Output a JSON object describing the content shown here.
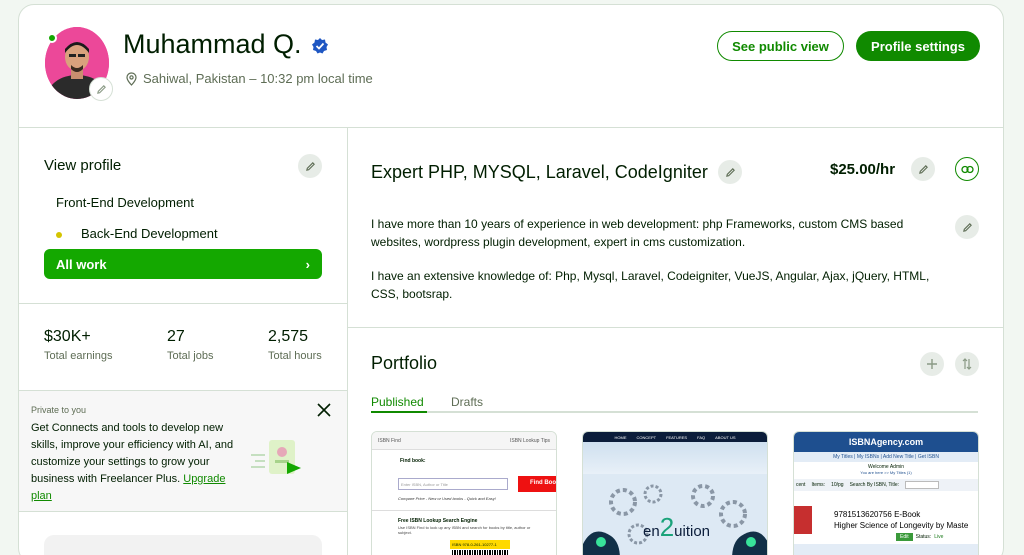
{
  "header": {
    "name": "Muhammad Q.",
    "location": "Sahiwal, Pakistan – 10:32 pm local time",
    "see_public_view": "See public view",
    "profile_settings": "Profile settings"
  },
  "sidebar": {
    "view_profile": "View profile",
    "specializations": [
      "Front-End Development",
      "Back-End Development"
    ],
    "all_work": "All work",
    "all_work_arrow": "›",
    "stats": [
      {
        "value": "$30K+",
        "label": "Total earnings"
      },
      {
        "value": "27",
        "label": "Total jobs"
      },
      {
        "value": "2,575",
        "label": "Total hours"
      }
    ],
    "promo": {
      "kicker": "Private to you",
      "text": "Get Connects and tools to develop new skills, improve your efficiency with AI, and customize your settings to grow your business with Freelancer Plus.",
      "link": "Upgrade plan"
    }
  },
  "main": {
    "title": "Expert PHP, MYSQL, Laravel, CodeIgniter",
    "rate": "$25.00/hr",
    "overview_p1": "I have more than 10 years of experience in web development: php Frameworks, custom CMS based websites, wordpress plugin development, expert in cms customization.",
    "overview_p2": "I have an extensive knowledge of: Php, Mysql, Laravel, Codeigniter, VueJS, Angular, Ajax, jQuery, HTML, CSS, bootsrap."
  },
  "portfolio": {
    "title": "Portfolio",
    "tabs": [
      "Published",
      "Drafts"
    ],
    "items": [
      {
        "header_left": "ISBN Find",
        "header_right": "ISBN Lookup Tips",
        "find_label": "Find book:",
        "input_placeholder": "Enter ISBN, Author or Title",
        "button": "Find Boo",
        "compare": "Compare Price - New or Used books - Quick and Easy!",
        "section_title": "Free ISBN Lookup Search Engine",
        "section_text": "Use ISBN Find to look up any ISBN and search for books by title, author or subject.",
        "barcode": "ISBN 978-0-261-10277-1"
      },
      {
        "nav": [
          "HOME",
          "CONCEPT",
          "FEATURES",
          "FAQ",
          "ABOUT US"
        ],
        "logo_a": "en",
        "logo_b": "2",
        "logo_c": "uition"
      },
      {
        "brand": "ISBNAgency.com",
        "nav": "My Titles  |  My ISBNs  |  Add New Title  |  Get ISBN",
        "welcome": "Welcome Admin",
        "breadcrumb": "You are here >> My Titles (1)",
        "filter_left": "cent",
        "filter_items": "Items:",
        "filter_per": "10/pg",
        "filter_search": "Search By ISBN, Title:",
        "isbn": "9781513620756 E-Book",
        "book_title": "Higher Science of Longevity by Maste",
        "edit": "Edit",
        "status_label": "Status:",
        "status": "Live"
      }
    ]
  },
  "colors": {
    "brand_green": "#108a00",
    "bright_green": "#14a800",
    "text": "#001e00",
    "muted": "#5e6d55"
  }
}
